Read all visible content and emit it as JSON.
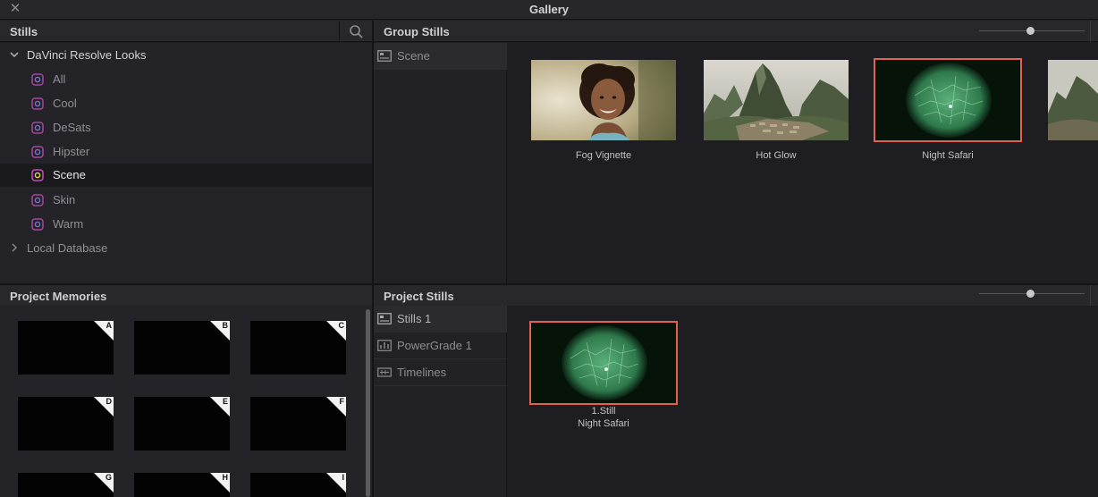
{
  "window": {
    "title": "Gallery",
    "close_glyph": "✕"
  },
  "stills_panel": {
    "header": "Stills",
    "tree": {
      "root": "DaVinci Resolve Looks",
      "items": [
        {
          "label": "All",
          "selected": false
        },
        {
          "label": "Cool",
          "selected": false
        },
        {
          "label": "DeSats",
          "selected": false
        },
        {
          "label": "Hipster",
          "selected": false
        },
        {
          "label": "Scene",
          "selected": true
        },
        {
          "label": "Skin",
          "selected": false
        },
        {
          "label": "Warm",
          "selected": false
        }
      ],
      "local": "Local Database"
    }
  },
  "group_stills": {
    "header": "Group Stills",
    "slider_value": 0.49,
    "album": {
      "label": "Scene"
    },
    "stills": [
      {
        "label": "Fog Vignette",
        "selected": false
      },
      {
        "label": "Hot Glow",
        "selected": false
      },
      {
        "label": "Night Safari",
        "selected": true
      },
      {
        "label": "",
        "selected": false
      }
    ]
  },
  "project_memories": {
    "header": "Project Memories",
    "slots": [
      "A",
      "B",
      "C",
      "D",
      "E",
      "F",
      "G",
      "H",
      "I"
    ]
  },
  "project_stills": {
    "header": "Project Stills",
    "slider_value": 0.49,
    "albums": [
      {
        "label": "Stills 1",
        "selected": true
      },
      {
        "label": "PowerGrade 1",
        "selected": false
      },
      {
        "label": "Timelines",
        "selected": false
      }
    ],
    "stills": [
      {
        "line1": "1.Still",
        "line2": "Night Safari",
        "selected": true
      }
    ]
  },
  "colors": {
    "accent_selection": "#e0634f",
    "album_icon_ring": "#c04ab5"
  }
}
